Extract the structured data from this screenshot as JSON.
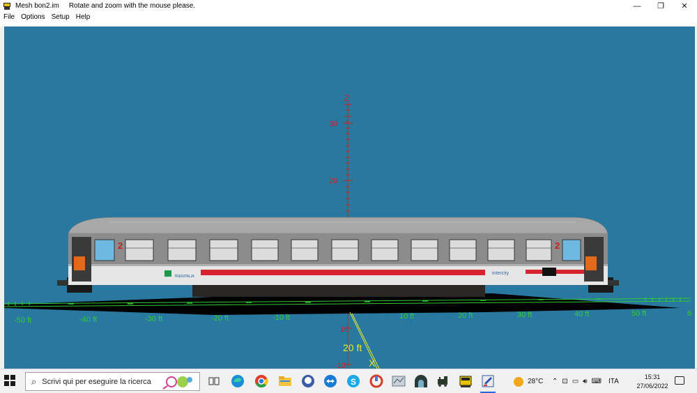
{
  "window": {
    "title": "Mesh bon2.im",
    "hint": "Rotate and zoom with the mouse please.",
    "controls": {
      "minimize": "—",
      "restore": "❐",
      "close": "✕"
    }
  },
  "menu": [
    "File",
    "Options",
    "Setup",
    "Help"
  ],
  "viewport": {
    "background": "#2878a0",
    "z_axis": {
      "label": "Z",
      "ticks": [
        "30",
        "20",
        "10",
        "-10"
      ],
      "color": "#cc2222"
    },
    "x_axis": {
      "label": "X",
      "ticks": [
        "20 ft"
      ],
      "color": "#e8e830"
    },
    "y_axis": {
      "ticks": [
        "-50 ft",
        "-40 ft",
        "-30 ft",
        "-20 ft",
        "-10 ft",
        "10 ft",
        "20 ft",
        "30 ft",
        "40 ft",
        "50 ft",
        "6"
      ],
      "color": "#33cc33"
    },
    "model": {
      "name": "Passenger coach",
      "logo_left": "TRENITALIA",
      "logo_right": "intercity",
      "coach_class": "2",
      "body_color": "#8c8c8c",
      "stripe_color": "#d8242e"
    }
  },
  "taskbar": {
    "search_placeholder": "Scrivi qui per eseguire la ricerca",
    "weather": "28°C",
    "language": "ITA",
    "time": "15:31",
    "date": "27/06/2022",
    "apps": [
      "task-view",
      "edge",
      "chrome",
      "file-explorer",
      "github",
      "teamviewer",
      "skype",
      "app-red",
      "app-map",
      "app-tunnel",
      "app-loco",
      "app-coach",
      "app-editor"
    ]
  }
}
